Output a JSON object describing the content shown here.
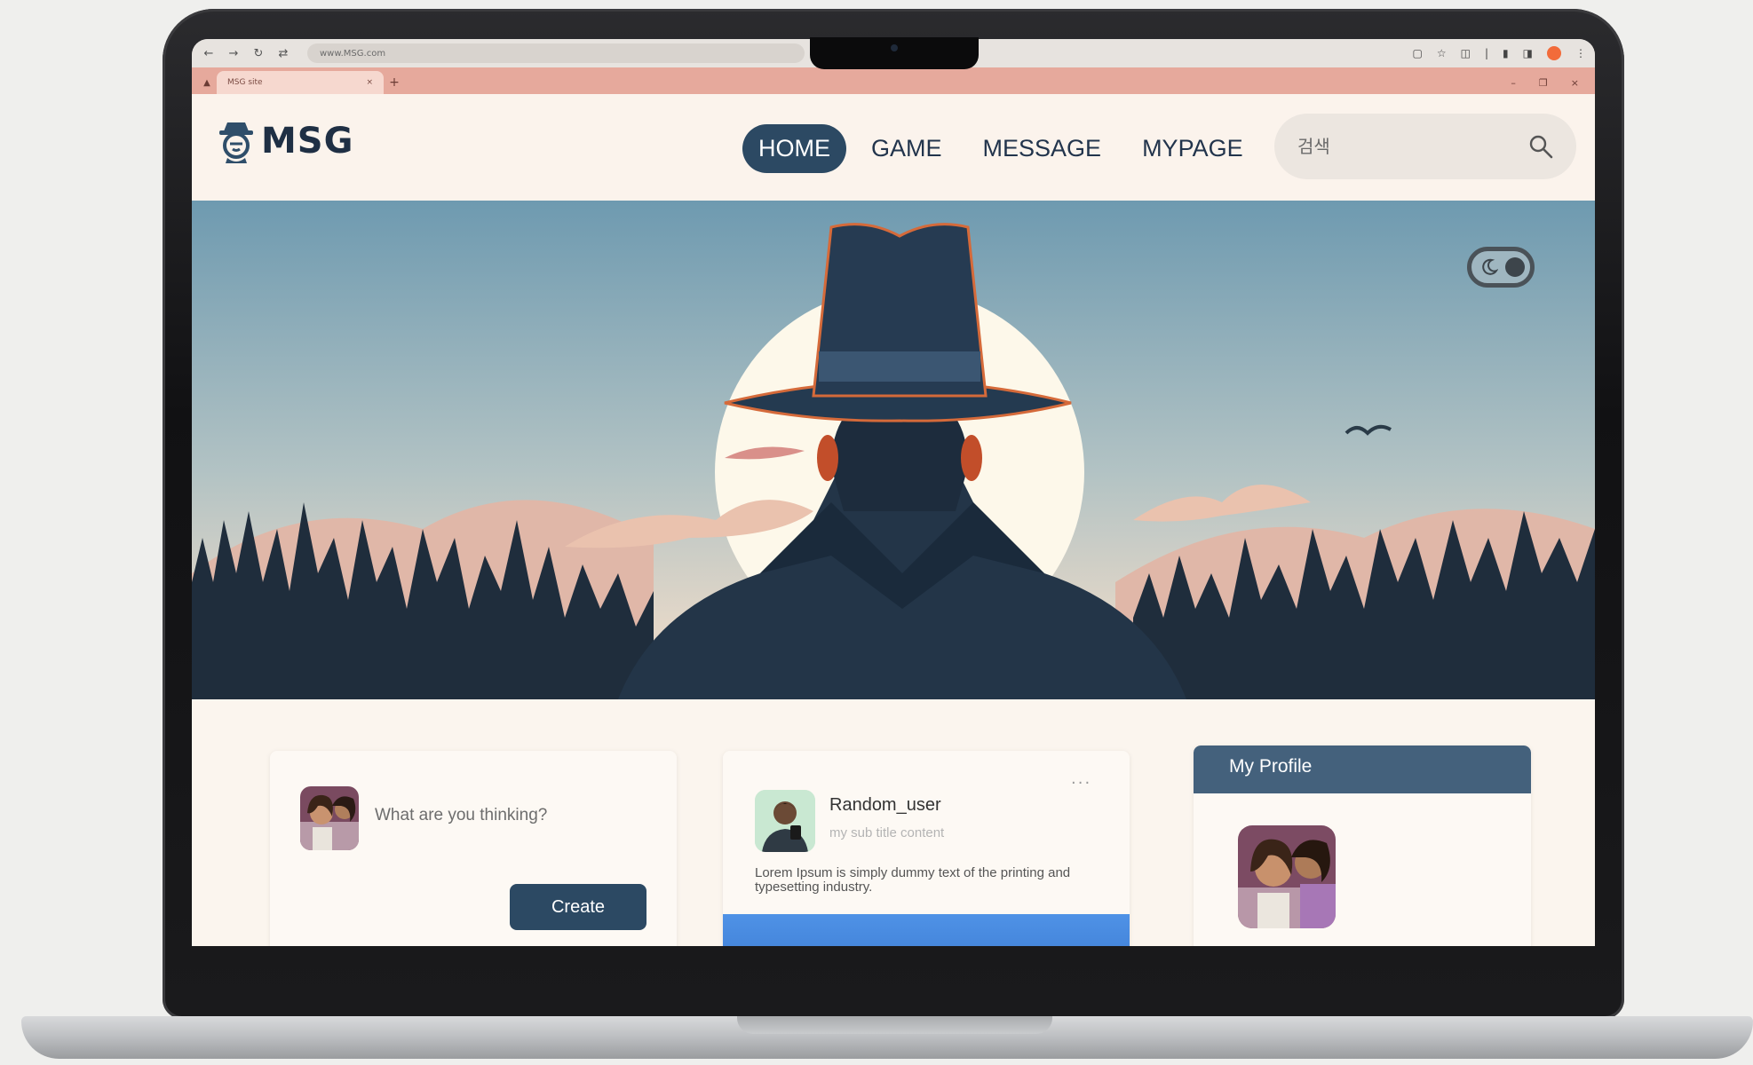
{
  "browser": {
    "url": "www.MSG.com",
    "tab_title": "MSG site"
  },
  "header": {
    "logo_text": "MSG",
    "nav": [
      {
        "label": "HOME",
        "active": true
      },
      {
        "label": "GAME",
        "active": false
      },
      {
        "label": "MESSAGE",
        "active": false
      },
      {
        "label": "MYPAGE",
        "active": false
      }
    ],
    "search_placeholder": "검색"
  },
  "hero": {
    "theme_toggle": "dark-mode-toggle"
  },
  "composer": {
    "prompt": "What are you thinking?",
    "create_label": "Create"
  },
  "post": {
    "username": "Random_user",
    "subtitle": "my sub title content",
    "body": "Lorem Ipsum is simply dummy text of the printing and typesetting industry.",
    "more_label": "···"
  },
  "profile": {
    "title": "My Profile"
  },
  "colors": {
    "primary": "#2c4963",
    "header_bg": "#fbf3ec",
    "tab_strip": "#e6a99c",
    "profile_head": "#44617c",
    "media_blue": "#4a8ae3"
  },
  "icons": [
    "back-arrow-icon",
    "forward-arrow-icon",
    "reload-icon",
    "site-settings-icon",
    "search-icon",
    "moon-icon",
    "more-dots-icon"
  ]
}
